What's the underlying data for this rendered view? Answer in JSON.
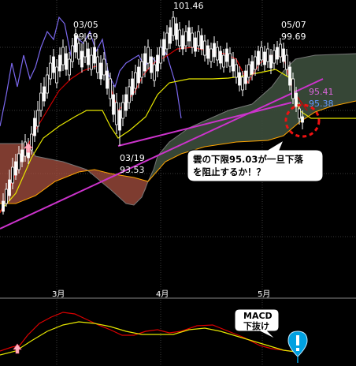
{
  "chart_data": {
    "type": "candlestick",
    "x_ticks": [
      "3月",
      "4月",
      "5月"
    ],
    "annotations": {
      "high_0305": {
        "date": "03/05",
        "price": "99.69"
      },
      "peak": {
        "price": "101.46"
      },
      "high_0507": {
        "date": "05/07",
        "price": "99.69"
      },
      "low_0319": {
        "date": "03/19",
        "price": "93.53"
      },
      "cloud_upper": {
        "price": "95.41"
      },
      "cloud_lower": {
        "price": "95.38"
      }
    },
    "main_comment": [
      "雲の下限95.03が一旦下落",
      "を阻止するか！？"
    ],
    "macd_comment": [
      "MACD",
      "下抜け"
    ],
    "colors": {
      "background": "#000000",
      "candle": "#ffffff",
      "tenkan": "#cc0000",
      "kijun": "#e6e600",
      "chikou": "#7b68ee",
      "trendline": "#cc33cc",
      "cloud_red": "#a85040",
      "cloud_green": "#3a4a3a",
      "cloud_edge_a": "#ffa500",
      "cloud_edge_b": "#555555",
      "macd": "#dd0000",
      "signal": "#e6e600",
      "alert": "#00a0e0"
    }
  }
}
